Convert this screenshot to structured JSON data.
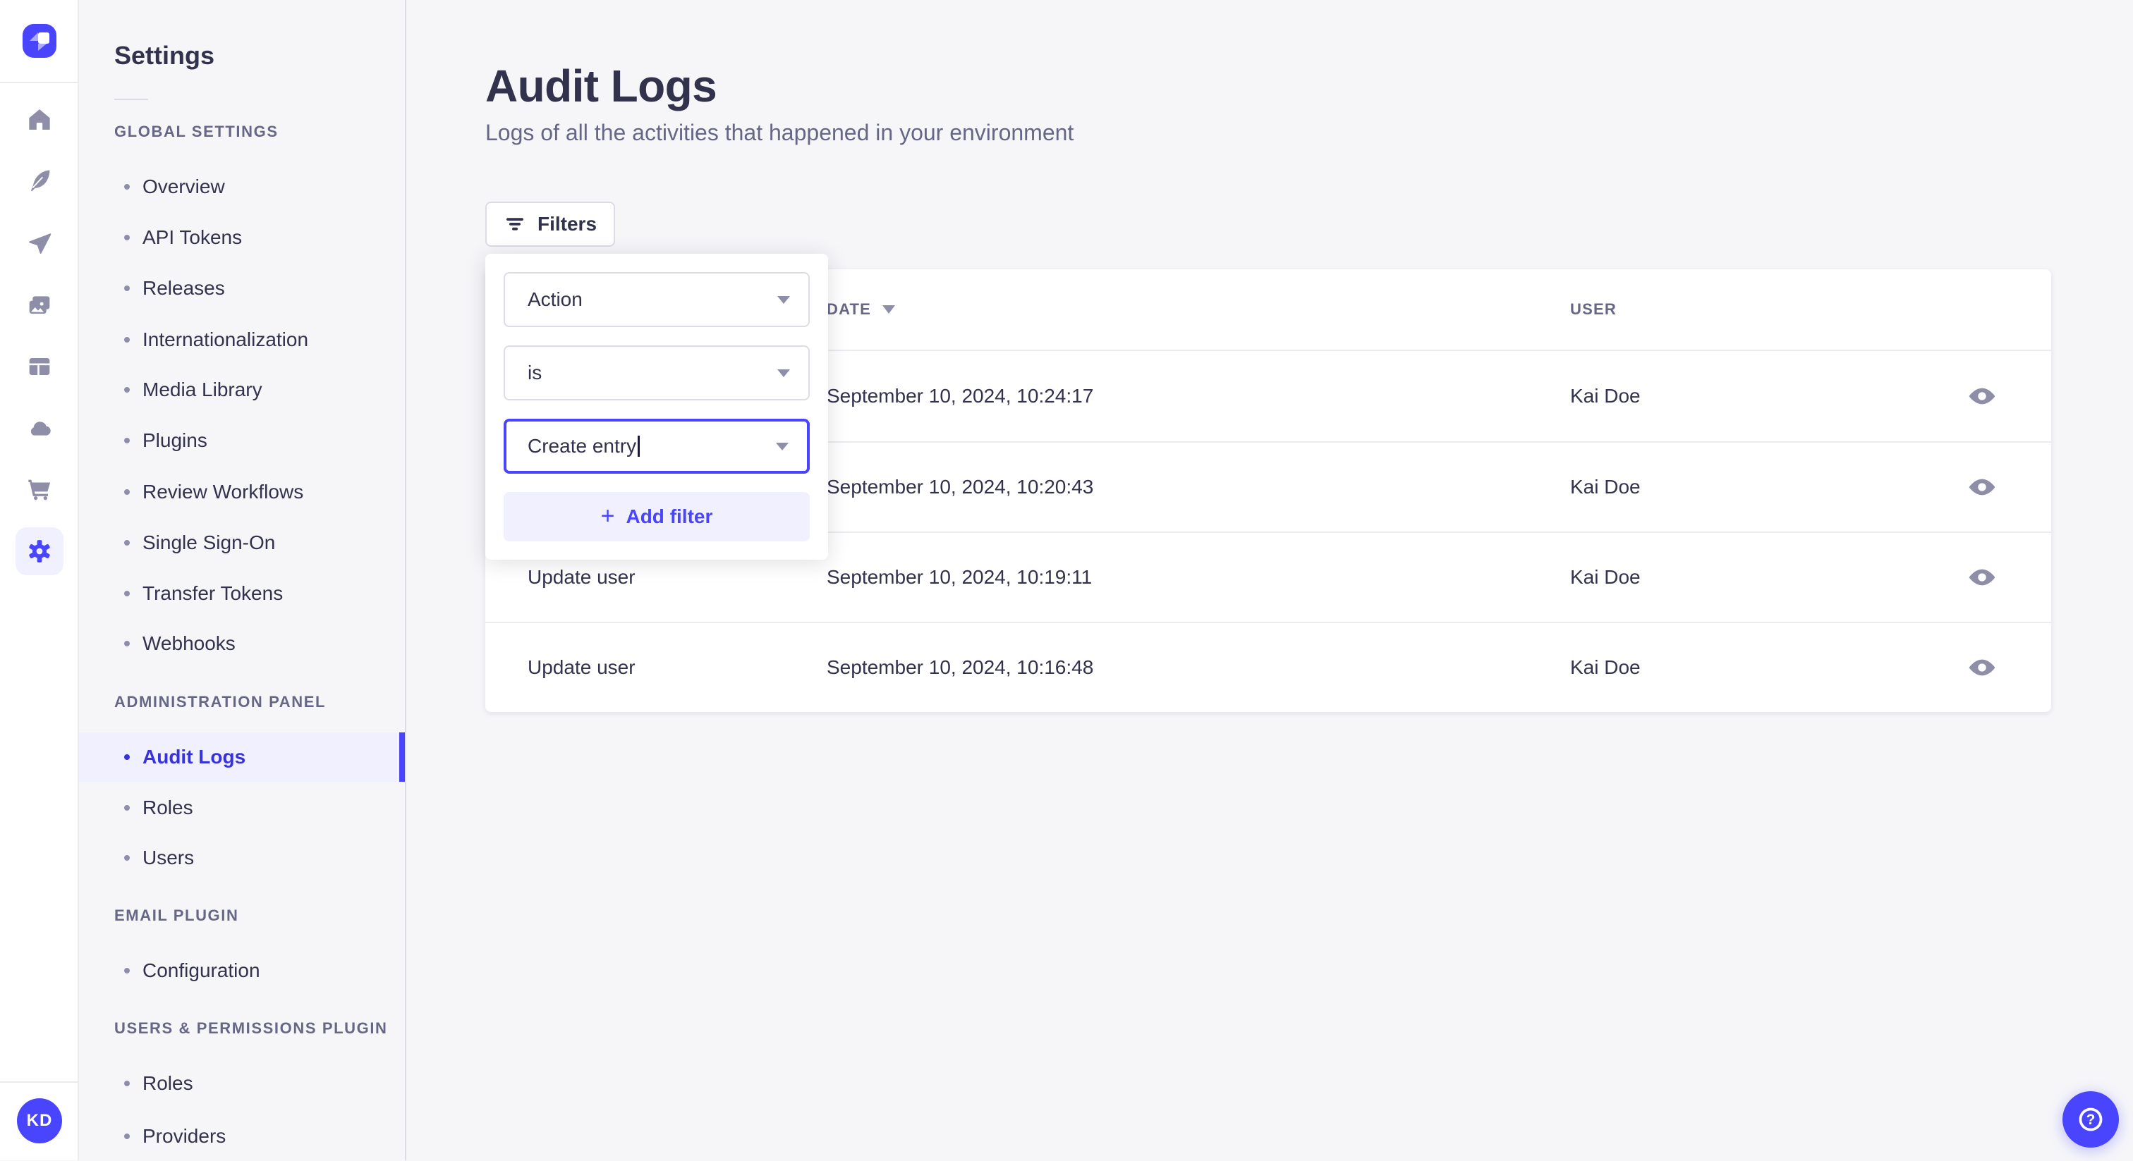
{
  "colors": {
    "accent": "#4945FF",
    "accent_light": "#F0F0FF",
    "active_text": "#3732E0",
    "text": "#32324D",
    "text_muted": "#666687",
    "icon_grey": "#8E8EA9",
    "border": "#DCDCE4",
    "divider": "#EAEAEF",
    "background": "#F6F6F9"
  },
  "rail": {
    "logo": "strapi-logo",
    "icons": [
      "home-icon",
      "feather-icon",
      "paper-plane-icon",
      "pictures-icon",
      "layout-icon",
      "cloud-icon",
      "cart-icon",
      "gear-icon"
    ],
    "active_icon": "gear-icon",
    "avatar_initials": "KD"
  },
  "sidebar": {
    "title": "Settings",
    "sections": [
      {
        "heading": "GLOBAL SETTINGS",
        "items": [
          {
            "label": "Overview"
          },
          {
            "label": "API Tokens"
          },
          {
            "label": "Releases"
          },
          {
            "label": "Internationalization"
          },
          {
            "label": "Media Library"
          },
          {
            "label": "Plugins"
          },
          {
            "label": "Review Workflows"
          },
          {
            "label": "Single Sign-On"
          },
          {
            "label": "Transfer Tokens"
          },
          {
            "label": "Webhooks"
          }
        ]
      },
      {
        "heading": "ADMINISTRATION PANEL",
        "items": [
          {
            "label": "Audit Logs",
            "active": true
          },
          {
            "label": "Roles"
          },
          {
            "label": "Users"
          }
        ]
      },
      {
        "heading": "EMAIL PLUGIN",
        "items": [
          {
            "label": "Configuration"
          }
        ]
      },
      {
        "heading": "USERS & PERMISSIONS PLUGIN",
        "items": [
          {
            "label": "Roles"
          },
          {
            "label": "Providers"
          }
        ]
      }
    ]
  },
  "main": {
    "title": "Audit Logs",
    "subtitle": "Logs of all the activities that happened in your environment",
    "filters_button_label": "Filters"
  },
  "filter_popover": {
    "field_value": "Action",
    "operator_value": "is",
    "value_value": "Create entry",
    "add_filter_label": "Add filter",
    "plus_glyph": "+"
  },
  "table": {
    "headers": {
      "date": "DATE",
      "user": "USER"
    },
    "rows": [
      {
        "action": "",
        "date": "September 10, 2024, 10:24:17",
        "user": "Kai Doe"
      },
      {
        "action": "",
        "date": "September 10, 2024, 10:20:43",
        "user": "Kai Doe"
      },
      {
        "action": "Update user",
        "date": "September 10, 2024, 10:19:11",
        "user": "Kai Doe"
      },
      {
        "action": "Update user",
        "date": "September 10, 2024, 10:16:48",
        "user": "Kai Doe"
      }
    ]
  },
  "help": {
    "glyph": "?"
  }
}
